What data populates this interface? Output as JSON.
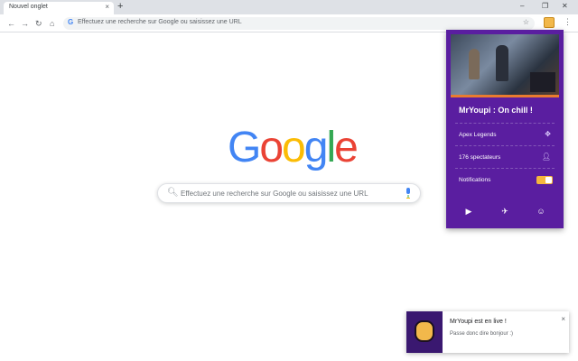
{
  "browser": {
    "tab_title": "Nouvel onglet",
    "tab_close": "×",
    "new_tab": "+",
    "window_minimize": "–",
    "window_restore": "❐",
    "window_close": "✕",
    "back": "←",
    "forward": "→",
    "reload": "↻",
    "home": "⌂",
    "omnibox_placeholder": "Effectuez une recherche sur Google ou saisissez une URL",
    "menu": "⋮"
  },
  "google": {
    "logo_letters": [
      "G",
      "o",
      "o",
      "g",
      "l",
      "e"
    ],
    "logo_colors": [
      "#4285f4",
      "#ea4335",
      "#fbbc05",
      "#4285f4",
      "#34a853",
      "#ea4335"
    ],
    "search_placeholder": "Effectuez une recherche sur Google ou saisissez une URL"
  },
  "popup": {
    "title": "MrYoupi : On chill !",
    "game": "Apex Legends",
    "viewers": "176 spectateurs",
    "notifications_label": "Notifications",
    "notifications_on": true,
    "bg_color": "#5a1ea0",
    "toggle_color": "#f5b63d",
    "icons": {
      "game": "gamepad-icon",
      "viewers": "person-icon",
      "social": [
        "youtube-icon",
        "twitter-icon",
        "discord-icon"
      ]
    }
  },
  "notification": {
    "title": "MrYoupi est en live !",
    "body": "Passe donc dire bonjour :)",
    "close": "×"
  }
}
